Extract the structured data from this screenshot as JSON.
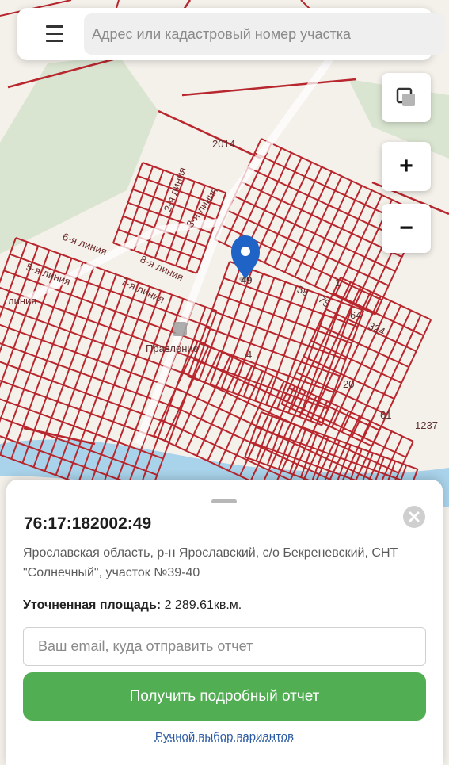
{
  "search": {
    "placeholder": "Адрес или кадастровый номер участка"
  },
  "map": {
    "labels": {
      "l2014": "2014",
      "l1237": "1237",
      "l49": "49",
      "l58": "58",
      "l75": "75",
      "l1": "1",
      "l64": "64",
      "l324": "324",
      "l4": "4",
      "l20": "20",
      "l61": "61",
      "pravlenie": "Правление",
      "liniya_6": "6-я линия",
      "liniya_5": "5-я линия",
      "liniya_8": "8-я линия",
      "liniya_7": "7-я линия",
      "liniya_3": "3-я линия",
      "liniya_2": "2-я линия",
      "liniya": "линия"
    },
    "colors": {
      "parcel_line": "#b8262e",
      "river": "#a9d3ea",
      "greenery": "#c8dcbf",
      "marker": "#1f63c6"
    }
  },
  "controls": {
    "zoom_in": "+",
    "zoom_out": "−"
  },
  "parcel": {
    "cadastral_number": "76:17:182002:49",
    "address": "Ярославская область, р-н Ярославский, с/о Бекреневский, СНТ \"Солнечный\", участок №39-40",
    "area_label": "Уточненная площадь:",
    "area_value": "2 289.61кв.м.",
    "email_placeholder": "Ваш email, куда отправить отчет",
    "report_button": "Получить подробный отчет",
    "manual_link": "Ручной выбор вариантов"
  }
}
